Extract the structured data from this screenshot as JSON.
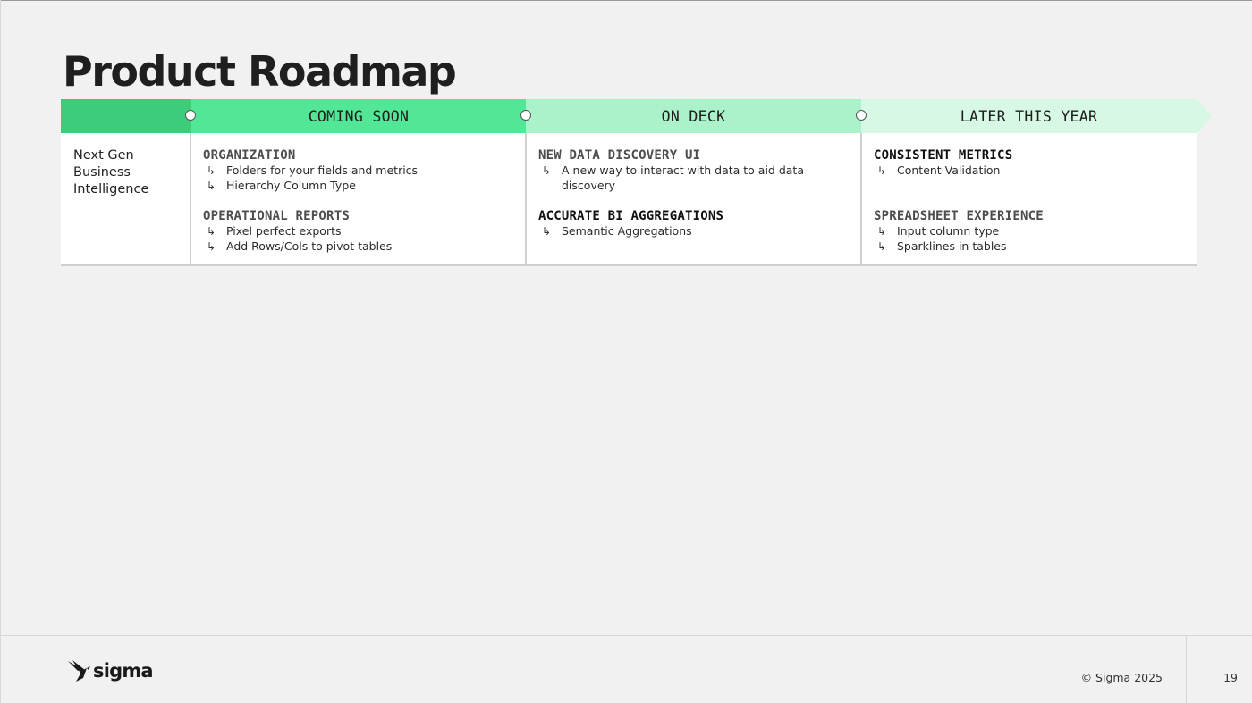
{
  "slide": {
    "title": "Product Roadmap",
    "page_number": "19",
    "copyright": "© Sigma 2025",
    "logo_text": "sigma"
  },
  "colors": {
    "accent_dark": "#3ecc7a",
    "coming_soon": "#52e697",
    "on_deck": "#abf2ca",
    "later_this_year": "#d7f8e4"
  },
  "roadmap": {
    "columns": [
      "COMING SOON",
      "ON DECK",
      "LATER THIS YEAR"
    ],
    "row_label": [
      "Next Gen",
      "Business",
      "Intelligence"
    ],
    "coming_soon": {
      "groups": [
        {
          "title": "ORGANIZATION",
          "items": [
            "Folders for your fields and metrics",
            "Hierarchy Column Type"
          ]
        },
        {
          "title": "OPERATIONAL REPORTS",
          "items": [
            "Pixel perfect exports",
            "Add Rows/Cols to pivot tables"
          ]
        }
      ]
    },
    "on_deck": {
      "groups": [
        {
          "title": "NEW DATA DISCOVERY UI",
          "items": [
            "A new way to interact with data to aid data",
            "discovery"
          ]
        },
        {
          "title": "ACCURATE BI AGGREGATIONS",
          "items": [
            "Semantic Aggregations"
          ]
        }
      ]
    },
    "later_this_year": {
      "groups": [
        {
          "title": "CONSISTENT METRICS",
          "items": [
            "Content Validation"
          ]
        },
        {
          "title": "SPREADSHEET EXPERIENCE",
          "items": [
            "Input column type",
            "Sparklines in tables"
          ]
        }
      ]
    },
    "arrow_glyph": "↳"
  }
}
